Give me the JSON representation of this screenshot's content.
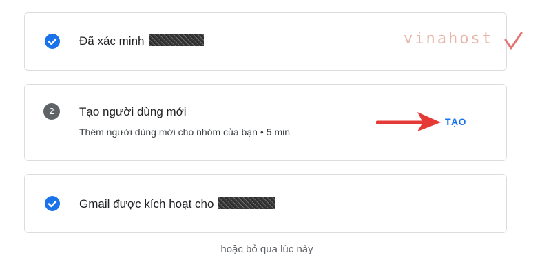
{
  "steps": [
    {
      "status": "done",
      "title": "Đã xác minh",
      "icon": "check-circle-icon"
    },
    {
      "status": "pending",
      "step_number": "2",
      "title": "Tạo người dùng mới",
      "subtitle": "Thêm người dùng mới cho nhóm của bạn",
      "separator": "•",
      "duration": "5 min",
      "action_label": "TẠO"
    },
    {
      "status": "done",
      "title": "Gmail được kích hoạt cho",
      "icon": "check-circle-icon"
    }
  ],
  "skip_label": "hoặc bỏ qua lúc này",
  "watermark": "vinahost",
  "colors": {
    "accent": "#1a73e8",
    "check": "#1a73e8",
    "arrow": "#e53935",
    "border": "#dadce0",
    "muted": "#5f6368"
  }
}
